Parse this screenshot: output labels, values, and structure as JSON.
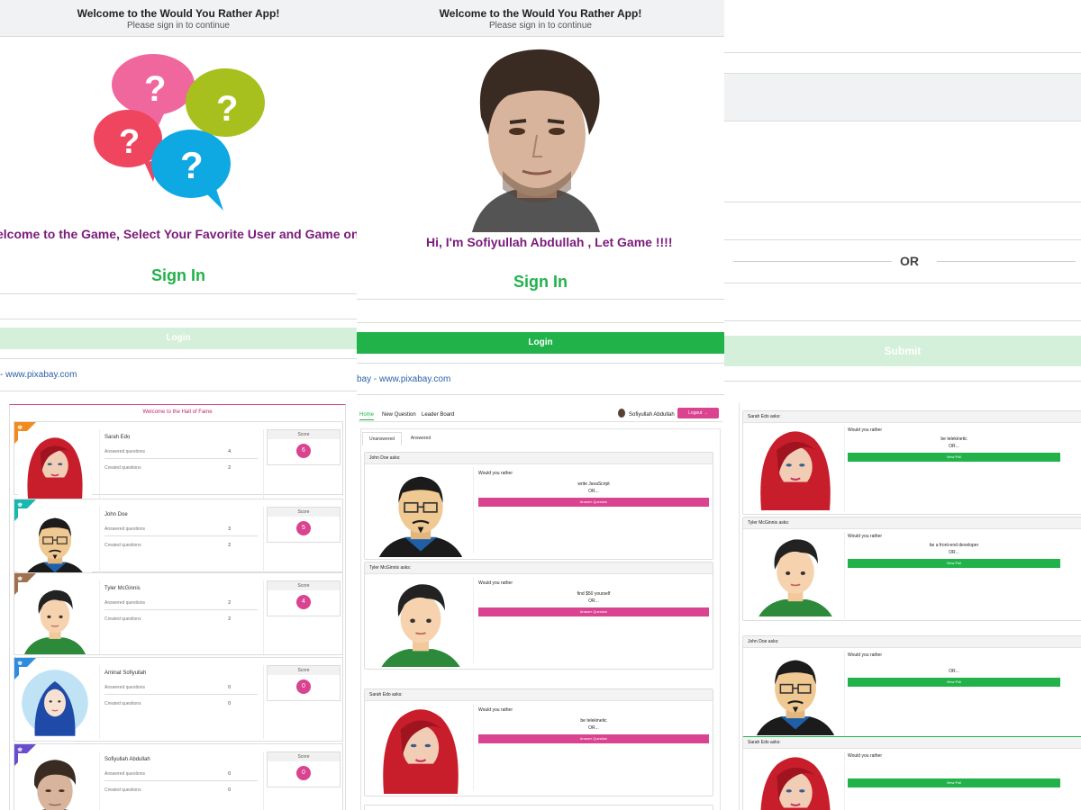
{
  "header": {
    "title": "Welcome to the Would You Rather App!",
    "subtitle": "Please sign in to continue"
  },
  "signin1": {
    "welcome_text": "elcome to the Game, Select Your Favorite User and Game on !!!!",
    "title": "Sign In",
    "login_label": "Login",
    "credit": "- www.pixabay.com"
  },
  "signin2": {
    "welcome_text": "Hi, I'm Sofiyullah Abdullah , Let Game !!!!",
    "title": "Sign In",
    "login_label": "Login",
    "credit": "bay - www.pixabay.com"
  },
  "leaderboard": {
    "title": "Welcome to the Hall of Fame",
    "score_header": "Score",
    "answered_label": "Answered questions",
    "created_label": "Created questions",
    "users": [
      {
        "name": "Sarah Edo",
        "answered": "4",
        "created": "2",
        "score": "6",
        "ribbon": "#f28a1e"
      },
      {
        "name": "John Doe",
        "answered": "3",
        "created": "2",
        "score": "5",
        "ribbon": "#18b8b0"
      },
      {
        "name": "Tyler McGinnis",
        "answered": "2",
        "created": "2",
        "score": "4",
        "ribbon": "#a0714e"
      },
      {
        "name": "Aminat Sofiyullah",
        "answered": "0",
        "created": "0",
        "score": "0",
        "ribbon": "#2d8be0"
      },
      {
        "name": "Sofiyullah Abdullah",
        "answered": "0",
        "created": "0",
        "score": "0",
        "ribbon": "#6a4ccf"
      }
    ]
  },
  "home": {
    "nav": {
      "home": "Home",
      "new_question": "New Question",
      "leader_board": "Leader Board",
      "user": "Sofiyullah Abdullah",
      "logout": "Logout"
    },
    "tabs": {
      "unanswered": "Unanswered",
      "answered": "Answered"
    },
    "would_you_rather": "Would you rather",
    "answer_button": "Answer Question",
    "questions": [
      {
        "author": "John Doe asks:",
        "option": "write JavaScript",
        "or": "OR..."
      },
      {
        "author": "Tyler McGinnis asks:",
        "option": "find $50 yourself",
        "or": "OR..."
      },
      {
        "author": "Sarah Edo asks:",
        "option": "be telekinetic",
        "or": "OR..."
      }
    ]
  },
  "col3": {
    "or_label": "OR",
    "submit_label": "Submit",
    "would_you_rather": "Would you rather",
    "questions": [
      {
        "author": "Sarah Edo asks:",
        "option": "be telekinetic",
        "or": "OR...",
        "button": "View Poll"
      },
      {
        "author": "Tyler McGinnis asks:",
        "option": "be a front-end developer",
        "or": "OR...",
        "button": "View Poll"
      },
      {
        "author": "John Doe asks:",
        "option": "",
        "or": "OR...",
        "button": "View Poll"
      },
      {
        "author": "Sarah Edo asks:",
        "option": "",
        "or": "",
        "button": "View Poll"
      }
    ]
  },
  "colors": {
    "primary_green": "#21b24a",
    "pale_green": "#d4f0da",
    "magenta": "#d9438f",
    "purple_text": "#7a1b7a",
    "link_blue": "#2b62a8"
  }
}
